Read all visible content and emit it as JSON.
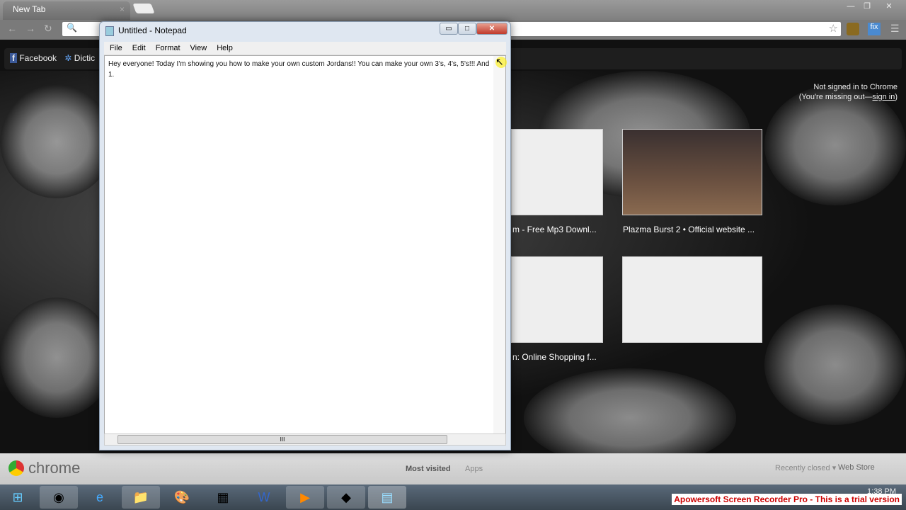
{
  "browser": {
    "tab_title": "New Tab",
    "bookmarks": [
      "Facebook",
      "Dictic"
    ],
    "signin_line1": "Not signed in to Chrome",
    "signin_line2_prefix": "(You're missing out—",
    "signin_link": "sign in",
    "signin_suffix": ")",
    "thumbnails": [
      "m - Free Mp3 Downl...",
      "Plazma Burst 2 • Official website ...",
      "n: Online Shopping f...",
      ""
    ],
    "footer": {
      "logo": "chrome",
      "most_visited": "Most visited",
      "apps": "Apps",
      "recently_closed": "Recently closed",
      "web_store": "Web Store"
    }
  },
  "notepad": {
    "title": "Untitled - Notepad",
    "menu": [
      "File",
      "Edit",
      "Format",
      "View",
      "Help"
    ],
    "text": "Hey everyone! Today I'm showing you how to make your own custom Jordans!! You can make your own 3's, 4's, 5's!!! And\n1."
  },
  "taskbar": {
    "apps": [
      "start",
      "chrome",
      "internet-explorer",
      "file-explorer",
      "paint",
      "calculator",
      "word",
      "media-player",
      "bluestacks",
      "notepad"
    ],
    "clock": "1:38 PM"
  },
  "watermark": "Apowersoft Screen Recorder Pro - This is a trial version"
}
